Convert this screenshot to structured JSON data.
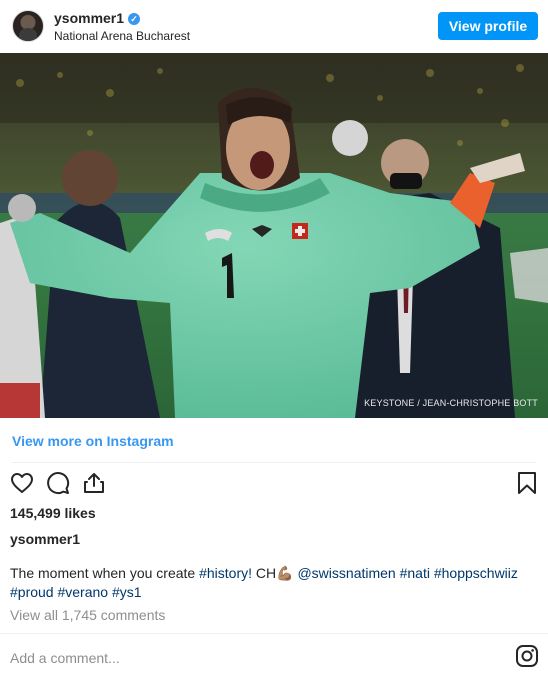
{
  "header": {
    "username": "ysommer1",
    "location": "National Arena Bucharest",
    "view_profile_label": "View profile"
  },
  "photo": {
    "credit": "KEYSTONE / JEAN-CHRISTOPHE BOTT"
  },
  "view_more_label": "View more on Instagram",
  "actions": {
    "like_icon": "heart-icon",
    "comment_icon": "comment-icon",
    "share_icon": "share-icon",
    "save_icon": "bookmark-icon"
  },
  "likes": "145,499 likes",
  "caption": {
    "owner": "ysommer1",
    "text_before": "The moment when you create ",
    "tag_history": "#history!",
    "emoji_text": " CH💪🏽 ",
    "mention": "@swissnatimen",
    "tag_nati": "#nati",
    "tag_hoppschwiiz": "#hoppschwiiz",
    "tag_proud": "#proud",
    "tag_verano": "#verano",
    "tag_ys1": "#ys1"
  },
  "view_all_comments": "View all 1,745 comments",
  "add_comment_placeholder": "Add a comment...",
  "colors": {
    "brand_blue": "#0095f6",
    "link_blue": "#3897f0",
    "hashtag": "#00376b",
    "jersey": "#7fe0bb"
  }
}
